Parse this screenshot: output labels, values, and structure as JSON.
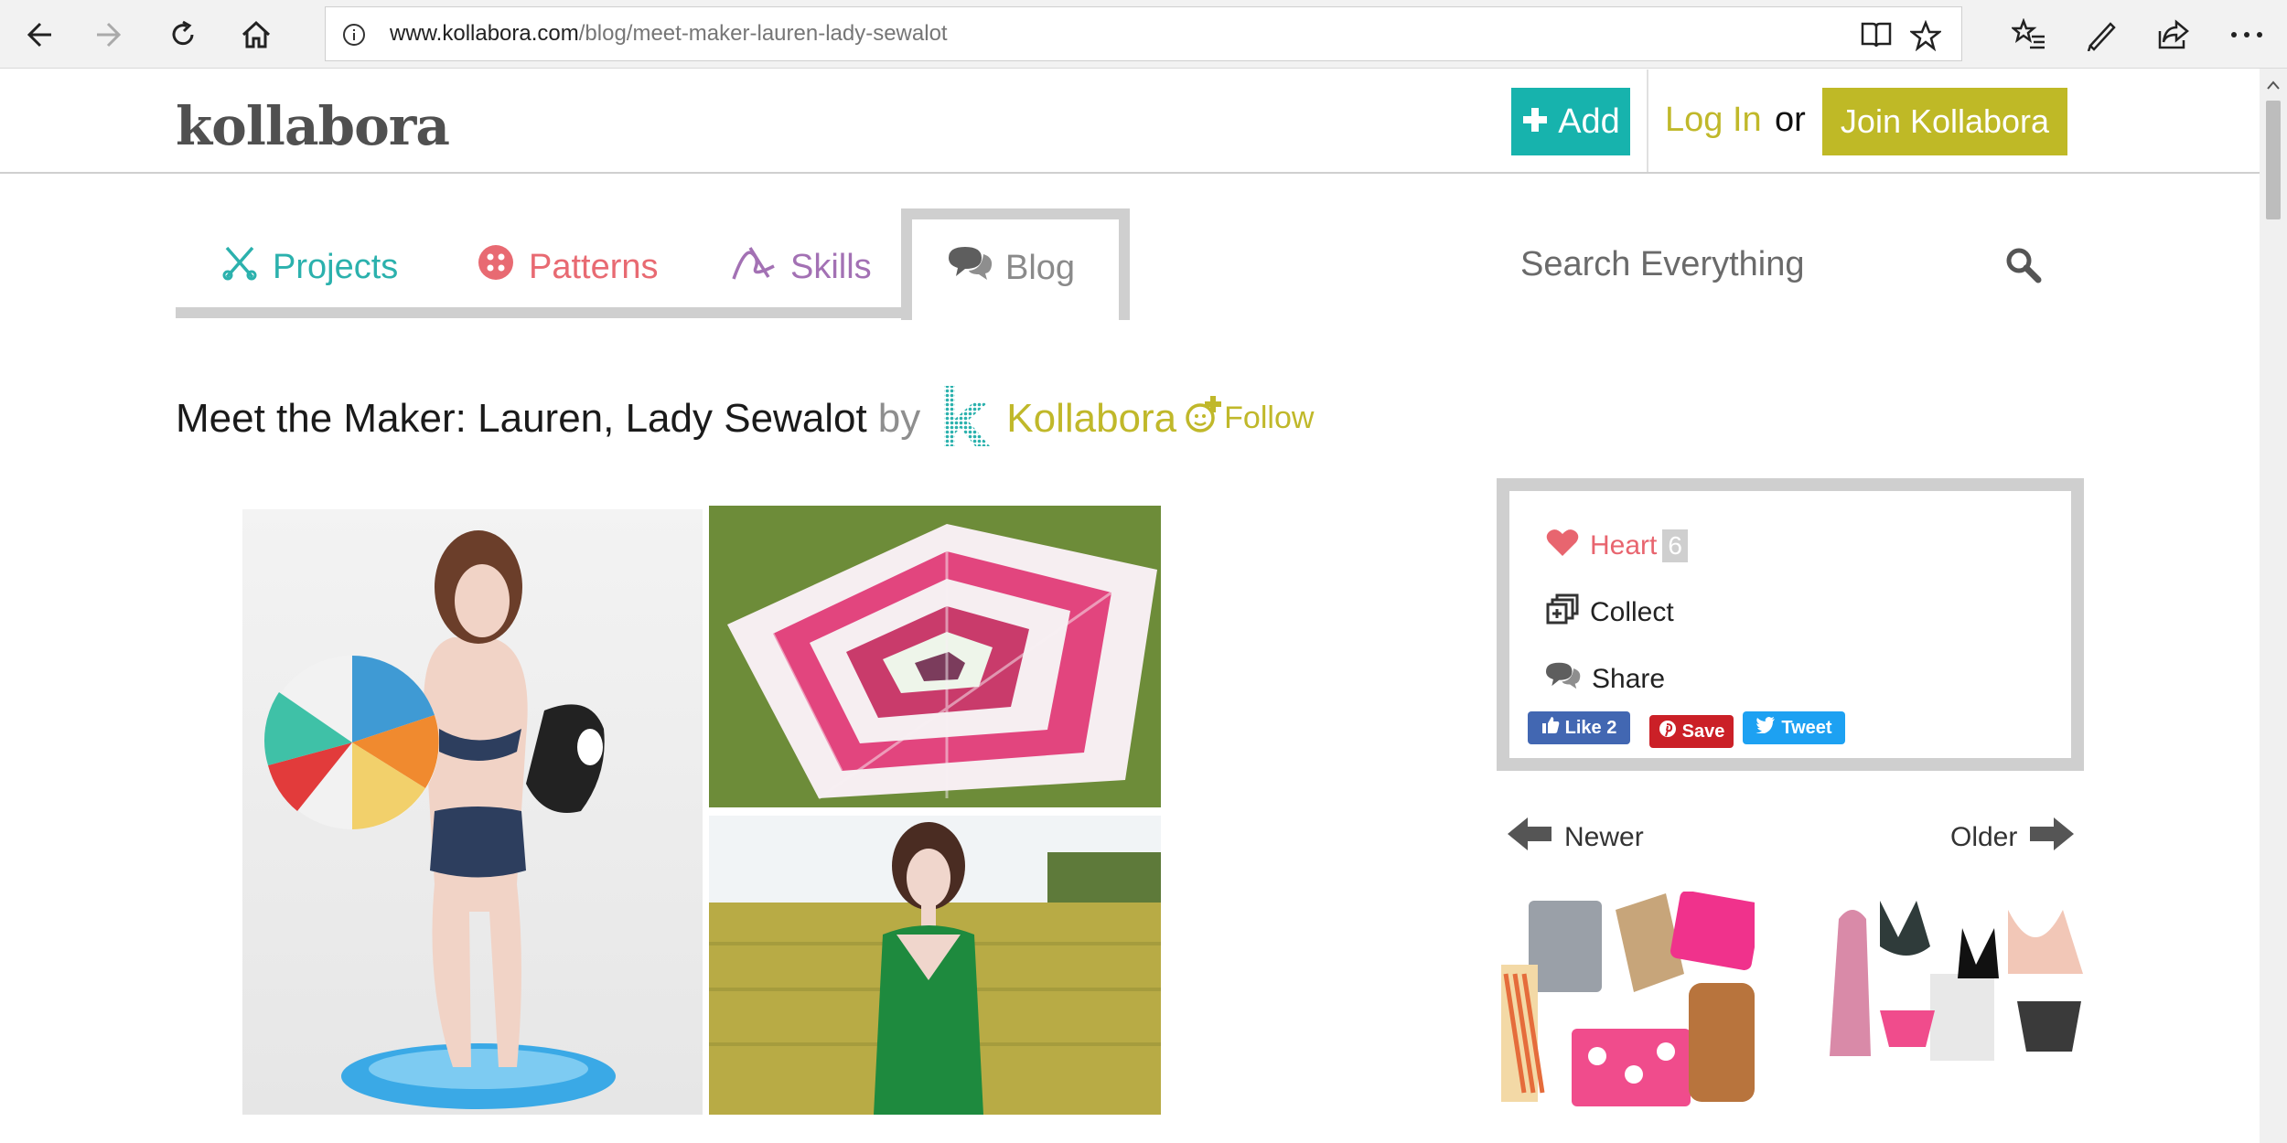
{
  "browser": {
    "url_domain": "www.kollabora.com",
    "url_path": "/blog/meet-maker-lauren-lady-sewalot"
  },
  "header": {
    "logo": "kollabora",
    "add_label": "Add",
    "login_label": "Log In",
    "or_label": "or",
    "join_label": "Join Kollabora"
  },
  "tabs": [
    {
      "label": "Projects",
      "color": "#2bb1ad"
    },
    {
      "label": "Patterns",
      "color": "#e86a72"
    },
    {
      "label": "Skills",
      "color": "#a371b4"
    },
    {
      "label": "Blog",
      "color": "#8a8a8a",
      "active": true
    }
  ],
  "search": {
    "placeholder": "Search Everything"
  },
  "post": {
    "title": "Meet the Maker: Lauren, Lady Sewalot",
    "by": "by",
    "author": "Kollabora",
    "follow": "Follow"
  },
  "actions": {
    "heart": "Heart",
    "heart_count": "6",
    "collect": "Collect",
    "share": "Share",
    "fb_like": "Like 2",
    "pin_save": "Save",
    "tweet": "Tweet"
  },
  "pager": {
    "newer": "Newer",
    "older": "Older"
  },
  "colors": {
    "teal": "#17b3ad",
    "olive": "#bfb926",
    "pink": "#e86a72",
    "purple": "#a371b4",
    "gray": "#cfcfcf"
  }
}
